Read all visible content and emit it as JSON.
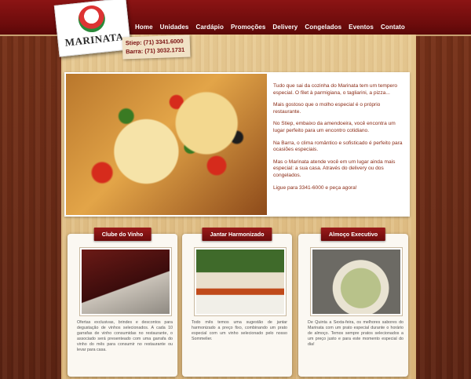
{
  "brand": {
    "name": "MARINATA"
  },
  "nav": [
    {
      "label": "Home"
    },
    {
      "label": "Unidades"
    },
    {
      "label": "Cardápio"
    },
    {
      "label": "Promoções"
    },
    {
      "label": "Delivery"
    },
    {
      "label": "Congelados"
    },
    {
      "label": "Eventos"
    },
    {
      "label": "Contato"
    }
  ],
  "phones": {
    "stiep": "Stiep: (71) 3341.6000",
    "barra": "Barra: (71) 3032.1731"
  },
  "hero": {
    "p1": "Tudo que sai da cozinha do Marinata tem um tempero especial. O filet à parmigiana, o tagliarini, a pizza...",
    "p2": "Mais gostoso que o molho especial é o próprio restaurante.",
    "p3": "No Stiep, embaixo da amendoeira, você encontra um lugar perfeito para um encontro cotidiano.",
    "p4": "Na Barra, o clima romântico e sofisticado é perfeito para ocasiões especiais.",
    "p5": "Mas o Marinata atende você em um lugar ainda mais especial: a sua casa. Através do delivery ou dos congelados.",
    "p6": "Ligue para 3341-6000 e peça agora!"
  },
  "cards": [
    {
      "title": "Clube do Vinho",
      "text": "Ofertas exclusivas, brindes e descontos para degustação de vinhos selecionados. A cada 10 garrafas de vinho consumidas no restaurante, o associado será presenteado com uma garrafa do vinho do mês para consumir no restaurante ou levar para casa."
    },
    {
      "title": "Jantar Harmonizado",
      "text": "Todo mês temos uma sugestão de jantar harmonizado a preço fixo, combinando um prato especial com um vinho selecionado pelo nosso Sommelier."
    },
    {
      "title": "Almoço Executivo",
      "text": "De Quinta a Sexta-feira, os melhores sabores do Marinata com um prato especial durante o horário de almoço. Temos sempre pratos selecionados a um preço justo e para este momento especial do dia!"
    }
  ]
}
